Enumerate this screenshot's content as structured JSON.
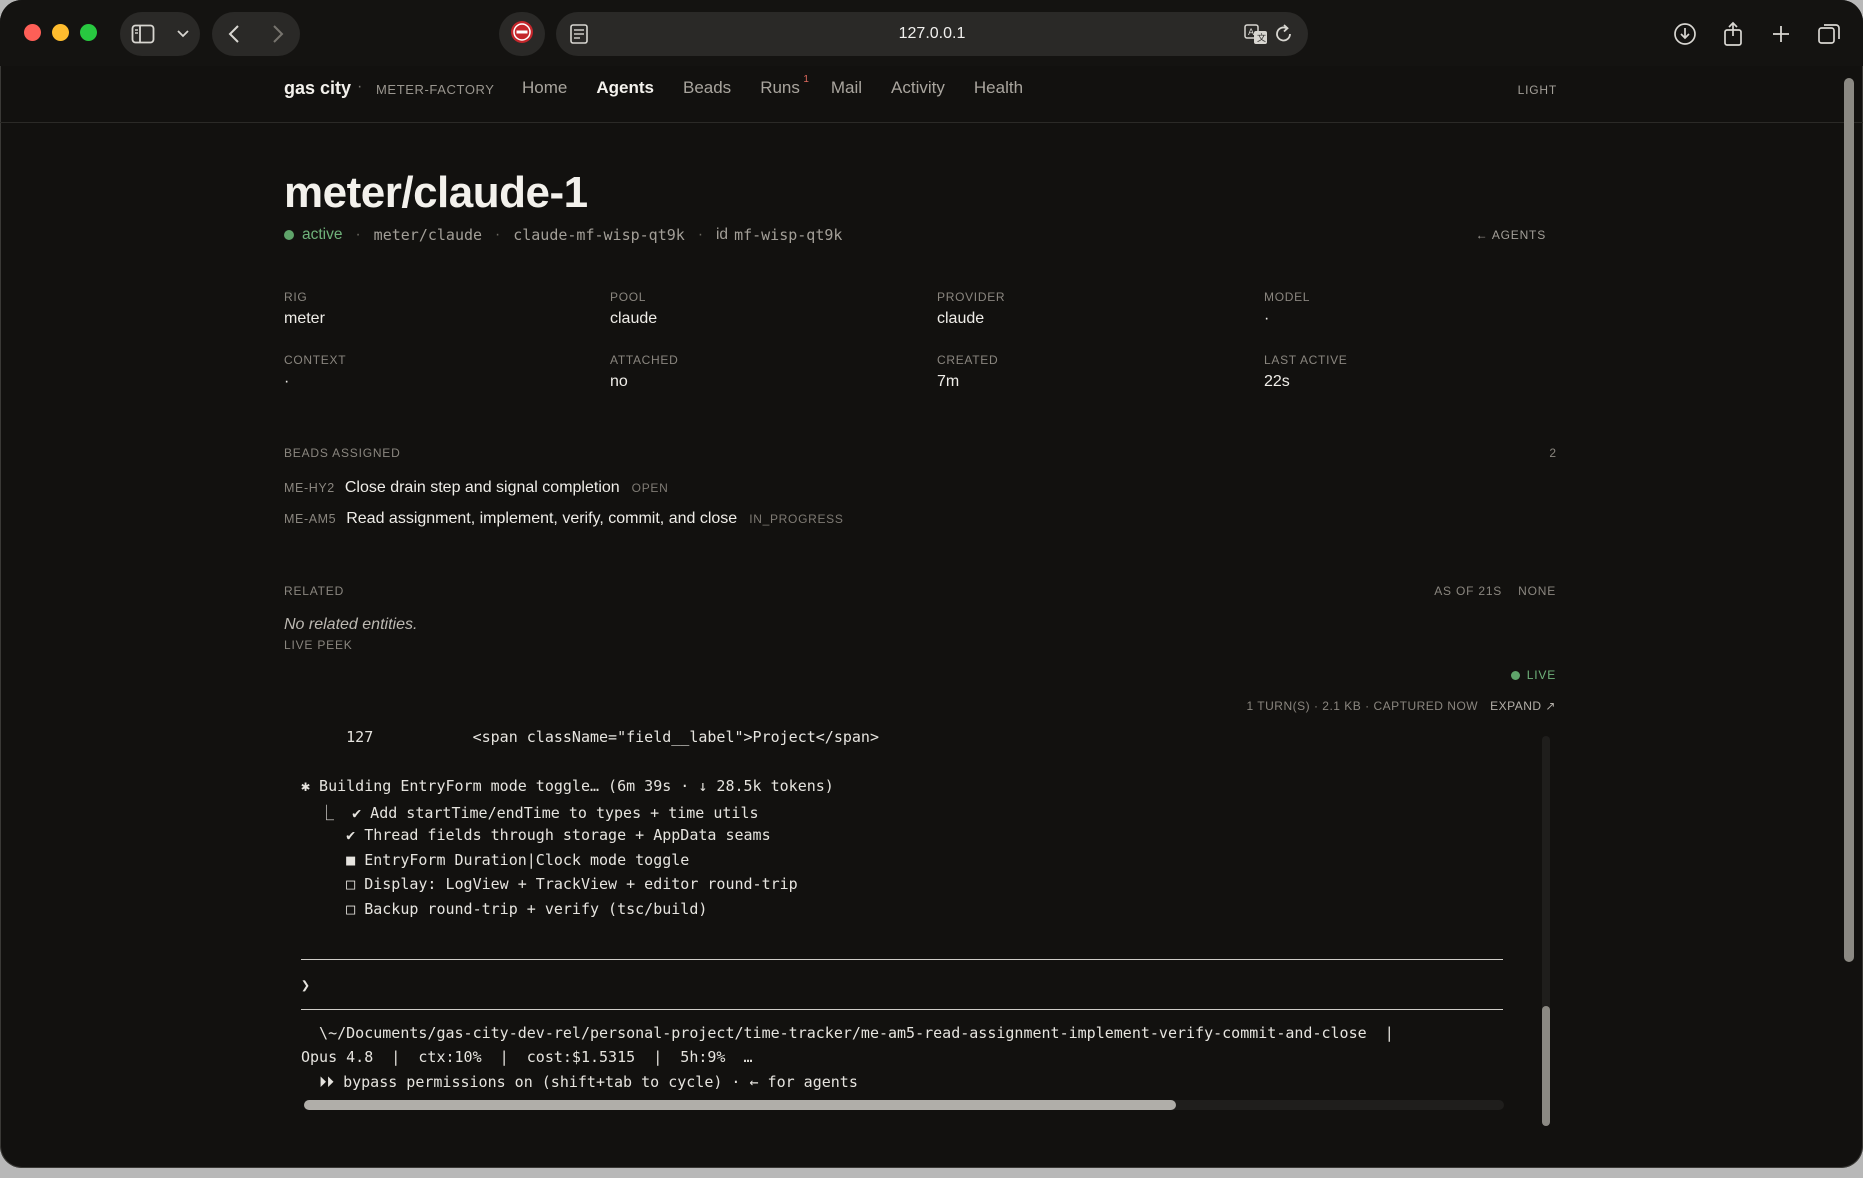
{
  "browser": {
    "url": "127.0.0.1"
  },
  "nav": {
    "brand": "gas city",
    "separator": "·",
    "factory": "METER-FACTORY",
    "links": [
      "Home",
      "Agents",
      "Beads",
      "Runs",
      "Mail",
      "Activity",
      "Health"
    ],
    "active": "Agents",
    "runs_badge": "1",
    "theme_toggle": "LIGHT"
  },
  "agent": {
    "title": "meter/claude-1",
    "status": "active",
    "template": "meter/claude",
    "session": "claude-mf-wisp-qt9k",
    "id_label": "id",
    "id": "mf-wisp-qt9k",
    "sep": "·",
    "back_link": "← AGENTS"
  },
  "fields": [
    {
      "label": "RIG",
      "value": "meter"
    },
    {
      "label": "POOL",
      "value": "claude"
    },
    {
      "label": "PROVIDER",
      "value": "claude"
    },
    {
      "label": "MODEL",
      "value": "·"
    },
    {
      "label": "CONTEXT",
      "value": "·"
    },
    {
      "label": "ATTACHED",
      "value": "no"
    },
    {
      "label": "CREATED",
      "value": "7m"
    },
    {
      "label": "LAST ACTIVE",
      "value": "22s"
    }
  ],
  "beads": {
    "label": "BEADS ASSIGNED",
    "count": "2",
    "items": [
      {
        "id": "ME-HY2",
        "title": "Close drain step and signal completion",
        "status": "OPEN"
      },
      {
        "id": "ME-AM5",
        "title": "Read assignment, implement, verify, commit, and close",
        "status": "IN_PROGRESS"
      }
    ]
  },
  "related": {
    "label": "RELATED",
    "as_of": "AS OF 21S",
    "filter": "NONE",
    "empty": "No related entities."
  },
  "peek": {
    "label": "LIVE PEEK",
    "live": "LIVE",
    "capture": "1 TURN(S) · 2.1 KB · CAPTURED NOW",
    "expand": "EXPAND ↗",
    "lines": {
      "l1": "     127           <span className=\"field__label\">Project</span>",
      "l2": "✱ Building EntryForm mode toggle… (6m 39s · ↓ 28.5k tokens)",
      "l3": "  ⎿  ✔ Add startTime/endTime to types + time utils",
      "l4": "     ✔ Thread fields through storage + AppData seams",
      "l5": "     ■ EntryForm Duration|Clock mode toggle",
      "l6": "     □ Display: LogView + TrackView + editor round-trip",
      "l7": "     □ Backup round-trip + verify (tsc/build)",
      "prompt": "❯",
      "path": "  \\~/Documents/gas-city-dev-rel/personal-project/time-tracker/me-am5-read-assignment-implement-verify-commit-and-close  |",
      "statusbar": "Opus 4.8  |  ctx:10%  |  cost:$1.5315  |  5h:9%  …",
      "hint": "  ⏵⏵ bypass permissions on (shift+tab to cycle) · ← for agents"
    }
  }
}
